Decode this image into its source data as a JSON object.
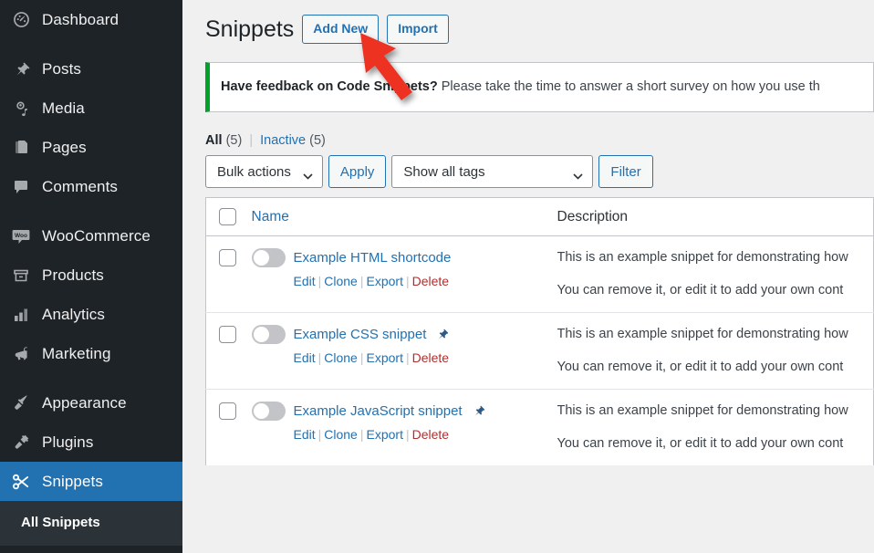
{
  "sidebar": {
    "items": [
      {
        "label": "Dashboard",
        "icon": "dashboard-icon",
        "sep_after": true
      },
      {
        "label": "Posts",
        "icon": "posts-pin-icon",
        "sep_after": false
      },
      {
        "label": "Media",
        "icon": "media-icon",
        "sep_after": false
      },
      {
        "label": "Pages",
        "icon": "pages-icon",
        "sep_after": false
      },
      {
        "label": "Comments",
        "icon": "comments-icon",
        "sep_after": true
      },
      {
        "label": "WooCommerce",
        "icon": "woocommerce-icon",
        "sep_after": false
      },
      {
        "label": "Products",
        "icon": "products-box-icon",
        "sep_after": false
      },
      {
        "label": "Analytics",
        "icon": "analytics-bars-icon",
        "sep_after": false
      },
      {
        "label": "Marketing",
        "icon": "marketing-megaphone-icon",
        "sep_after": true
      },
      {
        "label": "Appearance",
        "icon": "appearance-brush-icon",
        "sep_after": false
      },
      {
        "label": "Plugins",
        "icon": "plugins-plug-icon",
        "sep_after": false
      },
      {
        "label": "Snippets",
        "icon": "snippets-scissors-icon",
        "sep_after": false,
        "current": true
      }
    ],
    "submenu": [
      {
        "label": "All Snippets"
      }
    ],
    "colors": {
      "background": "#1d2327",
      "submenu_background": "#2c3338",
      "current_background": "#2271b1"
    }
  },
  "header": {
    "title": "Snippets",
    "actions": [
      {
        "label": "Add New",
        "name": "add-new-button"
      },
      {
        "label": "Import",
        "name": "import-button"
      }
    ]
  },
  "notice": {
    "bold_text": "Have feedback on Code Snippets?",
    "text": " Please take the time to answer a short survey on how you use th",
    "accent_color": "#00a32a"
  },
  "views": {
    "all_label": "All",
    "all_count": "(5)",
    "separator": "|",
    "inactive_label": "Inactive",
    "inactive_count": "(5)"
  },
  "tablenav": {
    "bulk_actions_label": "Bulk actions",
    "apply_label": "Apply",
    "tags_label": "Show all tags",
    "filter_label": "Filter"
  },
  "table": {
    "columns": {
      "name": "Name",
      "description": "Description"
    },
    "row_action_labels": {
      "edit": "Edit",
      "clone": "Clone",
      "export": "Export",
      "delete": "Delete"
    },
    "rows": [
      {
        "name": "Example HTML shortcode",
        "pinned": false,
        "active": false,
        "description_line1": "This is an example snippet for demonstrating how",
        "description_line2": "You can remove it, or edit it to add your own cont"
      },
      {
        "name": "Example CSS snippet",
        "pinned": true,
        "active": false,
        "description_line1": "This is an example snippet for demonstrating how",
        "description_line2": "You can remove it, or edit it to add your own cont"
      },
      {
        "name": "Example JavaScript snippet",
        "pinned": true,
        "active": false,
        "description_line1": "This is an example snippet for demonstrating how",
        "description_line2": "You can remove it, or edit it to add your own cont"
      }
    ]
  },
  "annotation": {
    "type": "red-arrow",
    "color": "#ee3124",
    "points_to": "Add New"
  }
}
